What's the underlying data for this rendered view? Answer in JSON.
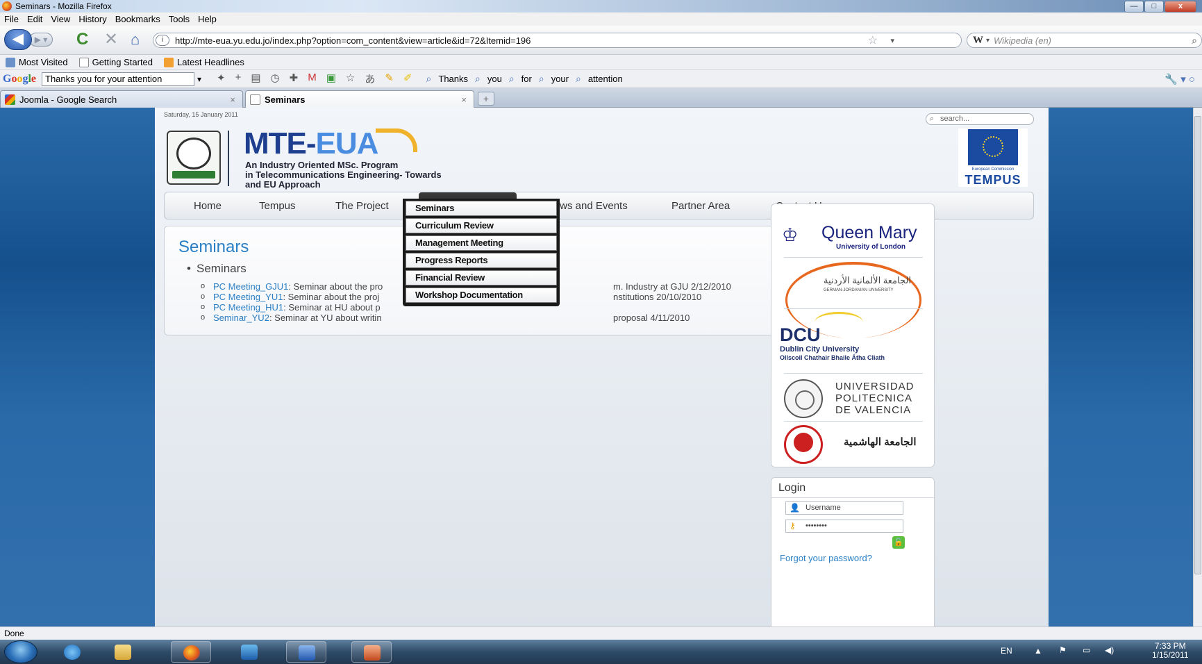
{
  "window": {
    "title": "Seminars - Mozilla Firefox",
    "controls": {
      "minimize": "—",
      "maximize": "□",
      "close": "x"
    }
  },
  "menubar": [
    "File",
    "Edit",
    "View",
    "History",
    "Bookmarks",
    "Tools",
    "Help"
  ],
  "navbar": {
    "url": "http://mte-eua.yu.edu.jo/index.php?option=com_content&view=article&id=72&Itemid=196",
    "search_engine": "W",
    "search_placeholder": "Wikipedia (en)"
  },
  "bookmarks": [
    "Most Visited",
    "Getting Started",
    "Latest Headlines"
  ],
  "google_toolbar": {
    "logo": "Google",
    "query": "Thanks you for your attention",
    "terms": [
      "Thanks",
      "you",
      "for",
      "your",
      "attention"
    ]
  },
  "tabs": [
    {
      "label": "Joomla - Google Search",
      "active": false
    },
    {
      "label": "Seminars",
      "active": true
    }
  ],
  "site": {
    "date": "Saturday, 15 January 2011",
    "search_placeholder": "search...",
    "logo_title_1": "MTE-",
    "logo_title_2": "EUA",
    "logo_sub": [
      "An Industry Oriented MSc. Program",
      "in Telecommunications Engineering- Towards",
      "and EU Approach"
    ],
    "tempus_ec": "European Commission",
    "tempus_label": "TEMPUS",
    "nav": [
      "Home",
      "Tempus",
      "The Project",
      "Documentation",
      "News and Events",
      "Partner Area",
      "Contact Us"
    ],
    "active_nav": "Documentation",
    "dropdown": [
      "Seminars",
      "Curriculum Review",
      "Management Meeting",
      "Progress Reports",
      "Financial Review",
      "Workshop Documentation"
    ],
    "page_title": "Seminars",
    "bullet": "Seminars",
    "items": [
      {
        "link": "PC Meeting_GJU1",
        "text_a": ": Seminar about the pro",
        "text_b": "m. Industry at GJU 2/12/2010"
      },
      {
        "link": "PC Meeting_YU1",
        "text_a": ": Seminar about the proj",
        "text_b": "nstitutions 20/10/2010"
      },
      {
        "link": "PC Meeting_HU1",
        "text_a": ": Seminar at HU about p",
        "text_b": ""
      },
      {
        "link": "Seminar_YU2",
        "text_a": ": Seminar at YU about writin",
        "text_b": "proposal 4/11/2010"
      }
    ],
    "partners": {
      "qm_name": "Queen Mary",
      "qm_sub": "University of London",
      "gju_ar": "الجامعة الألمانية الأردنية",
      "gju_en": "GERMAN-JORDANIAN UNIVERSITY",
      "dcu": "DCU",
      "dcu_1": "Dublin City University",
      "dcu_2": "Ollscoil Chathair Bhaile Átha Cliath",
      "upv": [
        "UNIVERSIDAD",
        "POLITECNICA",
        "DE VALENCIA"
      ],
      "hu_ar": "الجامعة الهاشمية"
    },
    "login": {
      "title": "Login",
      "username_placeholder": "Username",
      "password_value": "••••••••",
      "forgot": "Forgot your password?"
    }
  },
  "statusbar": "Done",
  "taskbar": {
    "lang": "EN",
    "time": "7:33 PM",
    "date": "1/15/2011"
  }
}
